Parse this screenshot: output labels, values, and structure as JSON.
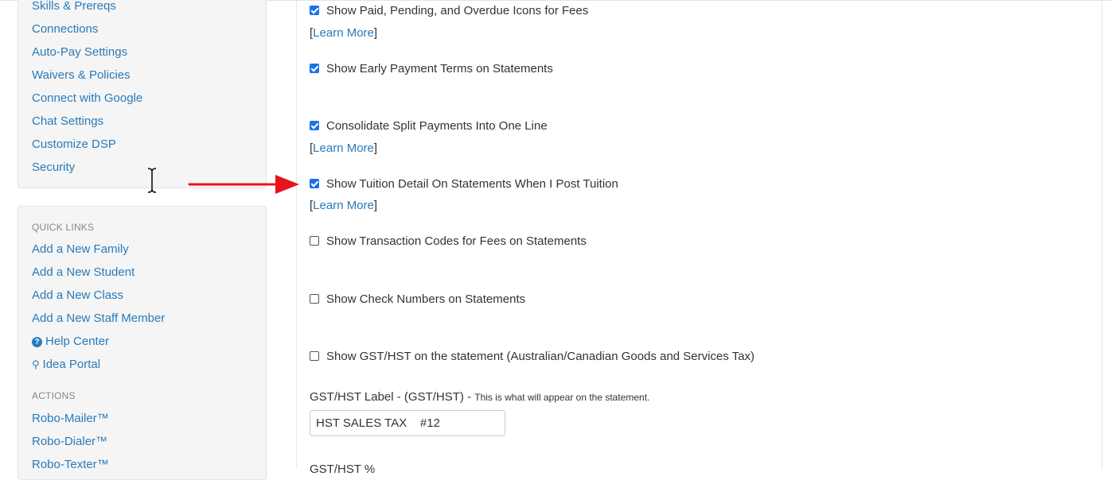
{
  "sidebar_top": {
    "items": [
      {
        "label": "Skills & Prereqs"
      },
      {
        "label": "Connections"
      },
      {
        "label": "Auto-Pay Settings"
      },
      {
        "label": "Waivers & Policies"
      },
      {
        "label": "Connect with Google"
      },
      {
        "label": "Chat Settings"
      },
      {
        "label": "Customize DSP"
      },
      {
        "label": "Security"
      }
    ]
  },
  "quick_links": {
    "header": "QUICK LINKS",
    "items": [
      {
        "label": "Add a New Family"
      },
      {
        "label": "Add a New Student"
      },
      {
        "label": "Add a New Class"
      },
      {
        "label": "Add a New Staff Member"
      },
      {
        "label": "Help Center",
        "icon": "question-circle-icon"
      },
      {
        "label": "Idea Portal",
        "icon": "lightbulb-icon"
      }
    ]
  },
  "actions": {
    "header": "ACTIONS",
    "items": [
      {
        "label": "Robo-Mailer™"
      },
      {
        "label": "Robo-Dialer™"
      },
      {
        "label": "Robo-Texter™"
      }
    ]
  },
  "settings": {
    "learn_more": "Learn More",
    "options": [
      {
        "label": "Show Paid, Pending, and Overdue Icons for Fees",
        "checked": true
      },
      {
        "label": "Show Early Payment Terms on Statements",
        "checked": true
      },
      {
        "label": "Consolidate Split Payments Into One Line",
        "checked": true
      },
      {
        "label": "Show Tuition Detail On Statements When I Post Tuition",
        "checked": true
      },
      {
        "label": "Show Transaction Codes for Fees on Statements",
        "checked": false
      },
      {
        "label": "Show Check Numbers on Statements",
        "checked": false
      },
      {
        "label": "Show GST/HST on the statement (Australian/Canadian Goods and Services Tax)",
        "checked": false
      }
    ],
    "gst_label": {
      "label": "GST/HST Label - (GST/HST) - ",
      "hint": "This is what will appear on the statement.",
      "value": "HST SALES TAX    #12"
    },
    "gst_percent_label": "GST/HST %"
  },
  "annotation": {
    "arrow_color": "#e8141b"
  }
}
